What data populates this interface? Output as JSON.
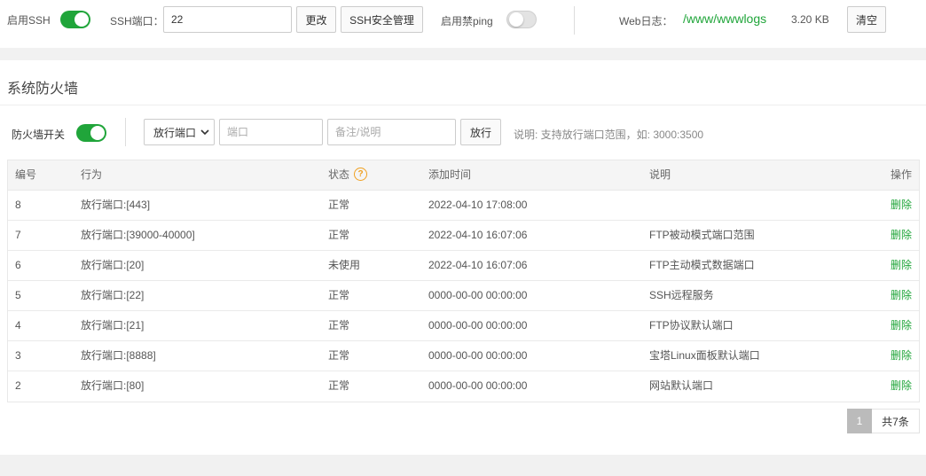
{
  "ssh_bar": {
    "enable_ssh_label": "启用SSH",
    "ssh_enabled": true,
    "ssh_port_label": "SSH端口：",
    "ssh_port_value": "22",
    "change_button": "更改",
    "ssh_security_button": "SSH安全管理",
    "disable_ping_label": "启用禁ping",
    "disable_ping_enabled": false,
    "web_log_label": "Web日志：",
    "web_log_path": "/www/wwwlogs",
    "web_log_size": "3.20 KB",
    "clear_button": "清空"
  },
  "firewall": {
    "section_title": "系统防火墙",
    "switch_label": "防火墙开关",
    "firewall_enabled": true,
    "action_select_value": "放行端口",
    "port_placeholder": "端口",
    "note_placeholder": "备注/说明",
    "add_button": "放行",
    "hint": "说明: 支持放行端口范围，如: 3000:3500"
  },
  "table": {
    "columns": [
      "编号",
      "行为",
      "状态",
      "添加时间",
      "说明",
      "操作"
    ],
    "status_help_icon": "?",
    "rows": [
      {
        "id": "8",
        "action": "放行端口:[443]",
        "status": "正常",
        "time": "2022-04-10 17:08:00",
        "desc": "",
        "op": "删除"
      },
      {
        "id": "7",
        "action": "放行端口:[39000-40000]",
        "status": "正常",
        "time": "2022-04-10 16:07:06",
        "desc": "FTP被动模式端口范围",
        "op": "删除"
      },
      {
        "id": "6",
        "action": "放行端口:[20]",
        "status": "未使用",
        "time": "2022-04-10 16:07:06",
        "desc": "FTP主动模式数据端口",
        "op": "删除"
      },
      {
        "id": "5",
        "action": "放行端口:[22]",
        "status": "正常",
        "time": "0000-00-00 00:00:00",
        "desc": "SSH远程服务",
        "op": "删除"
      },
      {
        "id": "4",
        "action": "放行端口:[21]",
        "status": "正常",
        "time": "0000-00-00 00:00:00",
        "desc": "FTP协议默认端口",
        "op": "删除"
      },
      {
        "id": "3",
        "action": "放行端口:[8888]",
        "status": "正常",
        "time": "0000-00-00 00:00:00",
        "desc": "宝塔Linux面板默认端口",
        "op": "删除"
      },
      {
        "id": "2",
        "action": "放行端口:[80]",
        "status": "正常",
        "time": "0000-00-00 00:00:00",
        "desc": "网站默认端口",
        "op": "删除"
      }
    ]
  },
  "pagination": {
    "current_page": "1",
    "total": "共7条"
  },
  "colors": {
    "accent_green": "#20a53a",
    "warning_orange": "#f0a020"
  }
}
